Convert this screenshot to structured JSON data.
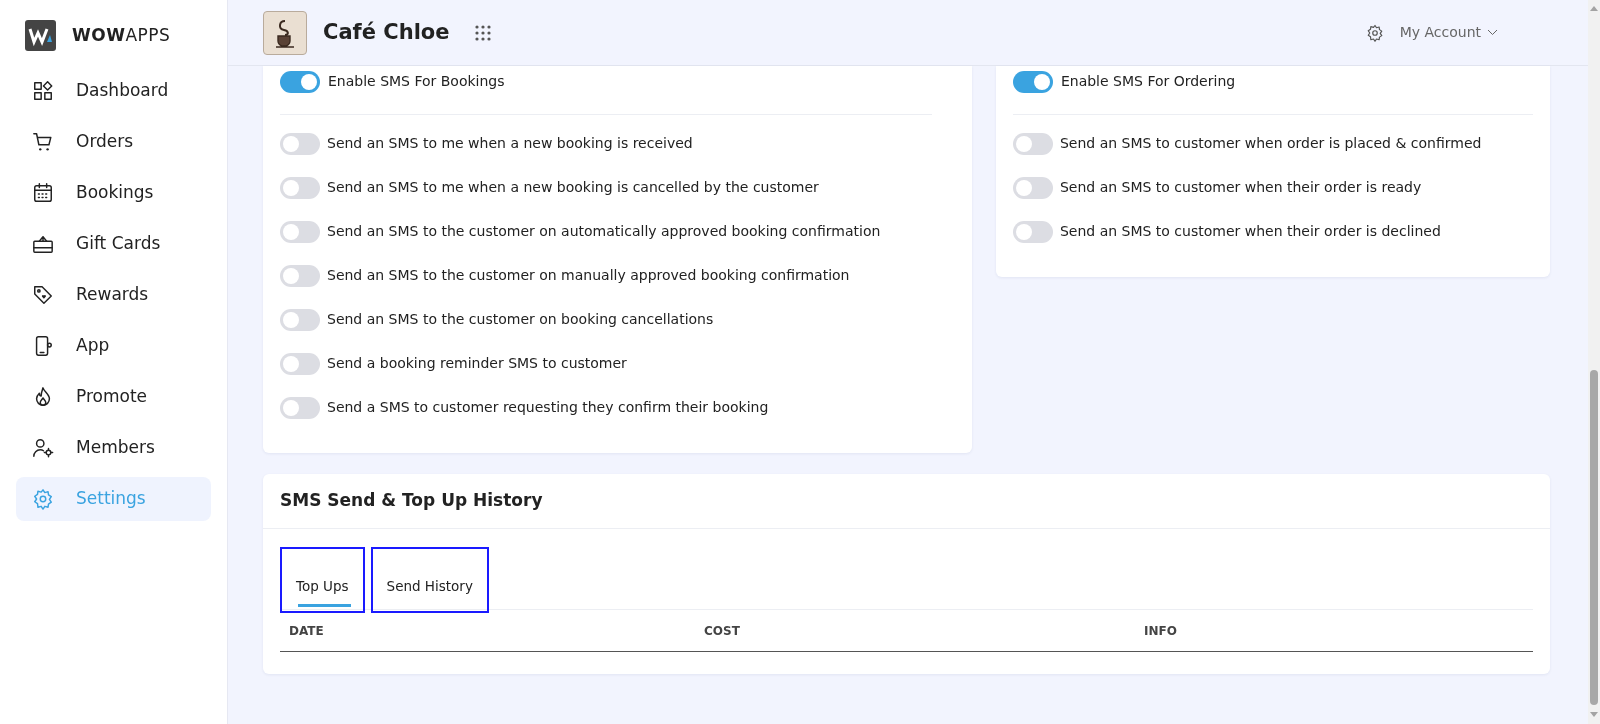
{
  "brand": {
    "name_bold": "WOW",
    "name_light": "APPS"
  },
  "sidebar": {
    "items": [
      {
        "label": "Dashboard",
        "kind": "grid",
        "selected": false
      },
      {
        "label": "Orders",
        "kind": "cart",
        "selected": false
      },
      {
        "label": "Bookings",
        "kind": "calendar",
        "selected": false
      },
      {
        "label": "Gift Cards",
        "kind": "gift",
        "selected": false
      },
      {
        "label": "Rewards",
        "kind": "tag",
        "selected": false
      },
      {
        "label": "App",
        "kind": "phone",
        "selected": false
      },
      {
        "label": "Promote",
        "kind": "flame",
        "selected": false
      },
      {
        "label": "Members",
        "kind": "members",
        "selected": false
      },
      {
        "label": "Settings",
        "kind": "gear",
        "selected": true
      }
    ]
  },
  "header": {
    "business_name": "Café Chloe",
    "account": "My Account"
  },
  "bookings_card": {
    "master": {
      "label": "Enable SMS For Bookings",
      "on": true
    },
    "options": [
      {
        "label": "Send an SMS to me when a new booking is received",
        "on": false
      },
      {
        "label": "Send an SMS to me when a new booking is cancelled by the customer",
        "on": false
      },
      {
        "label": "Send an SMS to the customer on automatically approved booking confirmation",
        "on": false
      },
      {
        "label": "Send an SMS to the customer on manually approved booking confirmation",
        "on": false
      },
      {
        "label": "Send an SMS to the customer on booking cancellations",
        "on": false
      },
      {
        "label": "Send a booking reminder SMS to customer",
        "on": false
      },
      {
        "label": "Send a SMS to customer requesting they confirm their booking",
        "on": false
      }
    ]
  },
  "ordering_card": {
    "master": {
      "label": "Enable SMS For Ordering",
      "on": true
    },
    "options": [
      {
        "label": "Send an SMS to customer when order is placed & confirmed",
        "on": false
      },
      {
        "label": "Send an SMS to customer when their order is ready",
        "on": false
      },
      {
        "label": "Send an SMS to customer when their order is declined",
        "on": false
      }
    ]
  },
  "history": {
    "title": "SMS Send & Top Up History",
    "tabs": [
      {
        "label": "Top Ups",
        "selected": true
      },
      {
        "label": "Send History",
        "selected": false
      }
    ],
    "table": {
      "columns": [
        "DATE",
        "COST",
        "INFO"
      ]
    }
  }
}
